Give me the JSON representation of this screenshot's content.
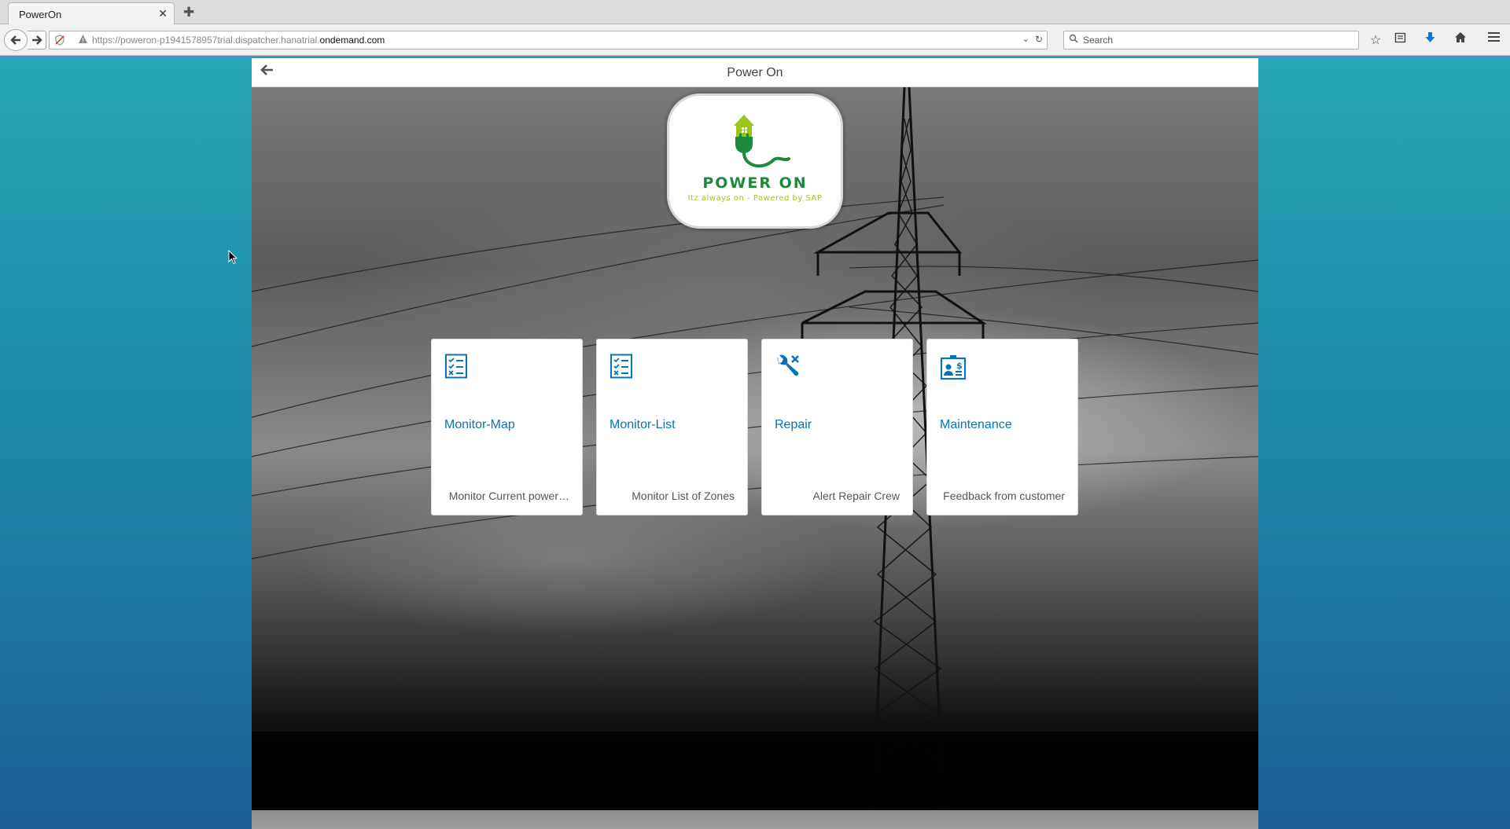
{
  "browser": {
    "tab_title": "PowerOn",
    "tab_close": "✕",
    "new_tab": "✚",
    "url_prefix": "https://poweron-p1941578957trial.dispatcher.hanatrial.",
    "url_domain": "ondemand.com",
    "search_placeholder": "Search"
  },
  "app": {
    "title": "Power On",
    "back_glyph": "🡐",
    "logo": {
      "title": "POWER ON",
      "subtitle": "Itz always on - Powered by SAP"
    },
    "tiles": [
      {
        "title": "Monitor-Map",
        "info": "Monitor Current power…",
        "icon": "task-list-icon"
      },
      {
        "title": "Monitor-List",
        "info": "Monitor List of Zones",
        "icon": "task-list-icon"
      },
      {
        "title": "Repair",
        "info": "Alert Repair Crew",
        "icon": "wrench-tools-icon"
      },
      {
        "title": "Maintenance",
        "info": "Feedback from customer",
        "icon": "customer-card-icon"
      }
    ]
  },
  "colors": {
    "tile_title": "#0a72b8",
    "logo_green": "#1b8a3a",
    "logo_lime": "#9cc41a",
    "page_bg_top": "#27a6b4",
    "page_bg_bottom": "#1b5e96"
  }
}
